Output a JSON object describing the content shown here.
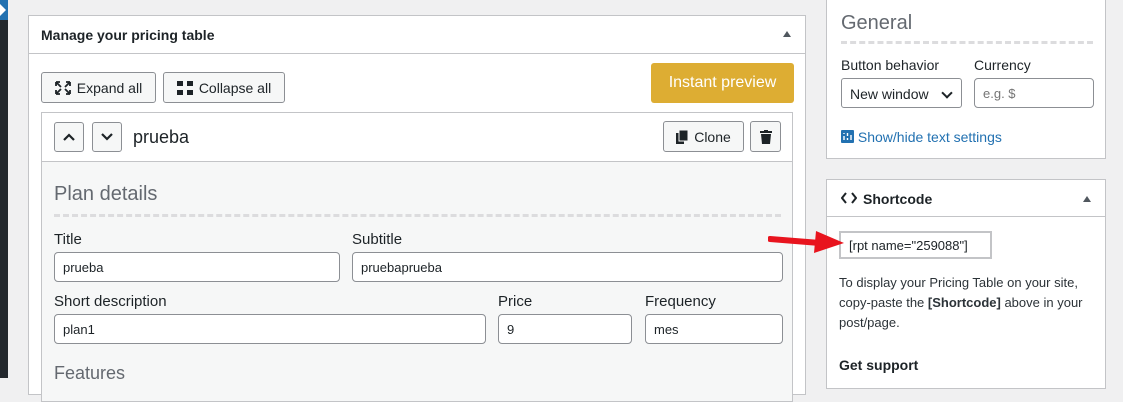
{
  "main": {
    "title": "Manage your pricing table",
    "expand_label": "Expand all",
    "collapse_label": "Collapse all",
    "preview_label": "Instant preview"
  },
  "plan": {
    "name": "prueba",
    "clone_label": "Clone",
    "details_title": "Plan details",
    "features_title": "Features",
    "fields": {
      "title_label": "Title",
      "title_value": "prueba",
      "subtitle_label": "Subtitle",
      "subtitle_value": "pruebaprueba",
      "short_desc_label": "Short description",
      "short_desc_value": "plan1",
      "price_label": "Price",
      "price_value": "9",
      "frequency_label": "Frequency",
      "frequency_value": "mes"
    }
  },
  "sidebar": {
    "general": {
      "title": "General",
      "button_behavior_label": "Button behavior",
      "button_behavior_value": "New window",
      "currency_label": "Currency",
      "currency_placeholder": "e.g. $",
      "toggle_text_link": "Show/hide text settings"
    },
    "shortcode": {
      "title": "Shortcode",
      "value": "[rpt name=\"259088\"]",
      "desc_before": "To display your Pricing Table on your site, copy-paste the ",
      "desc_bold": "[Shortcode]",
      "desc_after": " above in your post/page.",
      "support_label": "Get support"
    }
  },
  "colors": {
    "accent_button": "#ddad33",
    "link": "#2271b1",
    "annotation_arrow": "#e8141e"
  },
  "icons": [
    "expand-icon",
    "collapse-icon",
    "chevron-up-icon",
    "chevron-down-icon",
    "clone-icon",
    "trash-icon",
    "toggle-up-icon",
    "text-settings-icon",
    "code-icon",
    "red-arrow"
  ]
}
